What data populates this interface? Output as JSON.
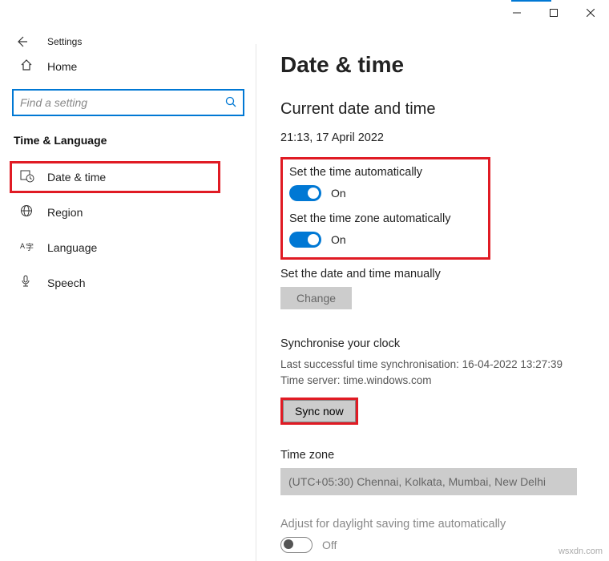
{
  "window": {
    "app_title": "Settings"
  },
  "sidebar": {
    "home_label": "Home",
    "search_placeholder": "Find a setting",
    "category": "Time & Language",
    "items": [
      {
        "label": "Date & time"
      },
      {
        "label": "Region"
      },
      {
        "label": "Language"
      },
      {
        "label": "Speech"
      }
    ]
  },
  "page": {
    "title": "Date & time",
    "current_heading": "Current date and time",
    "current_value": "21:13, 17 April 2022",
    "auto_time_label": "Set the time automatically",
    "auto_time_state": "On",
    "auto_tz_label": "Set the time zone automatically",
    "auto_tz_state": "On",
    "manual_label": "Set the date and time manually",
    "change_button": "Change",
    "sync_heading": "Synchronise your clock",
    "sync_last": "Last successful time synchronisation: 16-04-2022 13:27:39",
    "sync_server": "Time server: time.windows.com",
    "sync_button": "Sync now",
    "tz_heading": "Time zone",
    "tz_value": "(UTC+05:30) Chennai, Kolkata, Mumbai, New Delhi",
    "dst_label": "Adjust for daylight saving time automatically",
    "dst_state": "Off"
  },
  "watermark": "wsxdn.com"
}
